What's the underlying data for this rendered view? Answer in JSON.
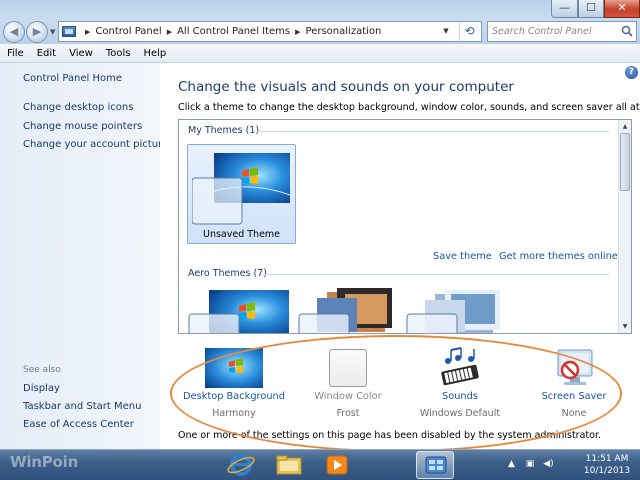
{
  "address_bar": {
    "breadcrumbs": [
      "Control Panel",
      "All Control Panel Items",
      "Personalization"
    ],
    "search_placeholder": "Search Control Panel"
  },
  "window_controls": {
    "minimize": "—",
    "maximize": "☐",
    "close": "✕"
  },
  "menu": [
    "File",
    "Edit",
    "View",
    "Tools",
    "Help"
  ],
  "sidebar": {
    "home": "Control Panel Home",
    "links": [
      "Change desktop icons",
      "Change mouse pointers",
      "Change your account picture"
    ],
    "see_also_label": "See also",
    "see_also": [
      "Display",
      "Taskbar and Start Menu",
      "Ease of Access Center"
    ]
  },
  "main": {
    "title": "Change the visuals and sounds on your computer",
    "subtitle": "Click a theme to change the desktop background, window color, sounds, and screen saver all at once.",
    "my_themes_label": "My Themes (1)",
    "unsaved_theme": "Unsaved Theme",
    "save_theme": "Save theme",
    "get_more_themes": "Get more themes online",
    "aero_themes_label": "Aero Themes (7)"
  },
  "settings": [
    {
      "title": "Desktop Background",
      "value": "Harmony",
      "enabled": true,
      "icon": "desktop-background-icon"
    },
    {
      "title": "Window Color",
      "value": "Frost",
      "enabled": false,
      "icon": "window-color-icon"
    },
    {
      "title": "Sounds",
      "value": "Windows Default",
      "enabled": true,
      "icon": "sounds-icon"
    },
    {
      "title": "Screen Saver",
      "value": "None",
      "enabled": true,
      "icon": "screen-saver-icon"
    }
  ],
  "notice": "One or more of the settings on this page has been disabled by the system administrator.",
  "taskbar": {
    "watermark": "WinPoin",
    "time": "11:51 AM",
    "date": "10/1/2013"
  },
  "colors": {
    "link": "#1a55a8",
    "title": "#1e3b6b",
    "highlight_ring": "#e8893a",
    "taskbar": "#2f537e"
  }
}
